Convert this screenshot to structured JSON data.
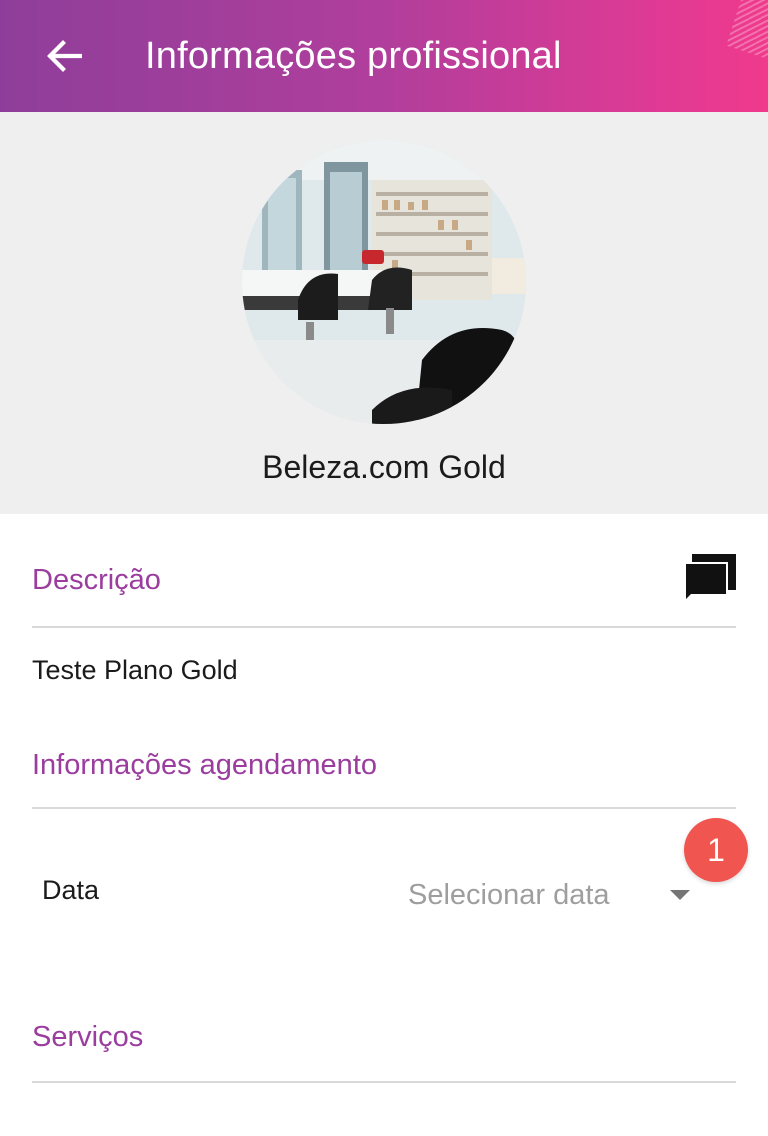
{
  "app_bar": {
    "title": "Informações profissional",
    "back_icon": "arrow-left-icon",
    "gradient": [
      "#8e3e9a",
      "#f03a8c"
    ]
  },
  "profile": {
    "name": "Beleza.com Gold",
    "avatar_alt": "salão de beleza"
  },
  "description": {
    "title": "Descrição",
    "icon": "chat-bubbles-icon",
    "text": "Teste Plano Gold"
  },
  "scheduling": {
    "title": "Informações agendamento",
    "date_label": "Data",
    "date_placeholder": "Selecionar data",
    "dropdown_icon": "caret-down-icon",
    "badge": "1",
    "badge_color": "#f0554f"
  },
  "services": {
    "title": "Serviços"
  },
  "colors": {
    "accent": "#9a3d9f",
    "header_bg": "#efefef"
  }
}
